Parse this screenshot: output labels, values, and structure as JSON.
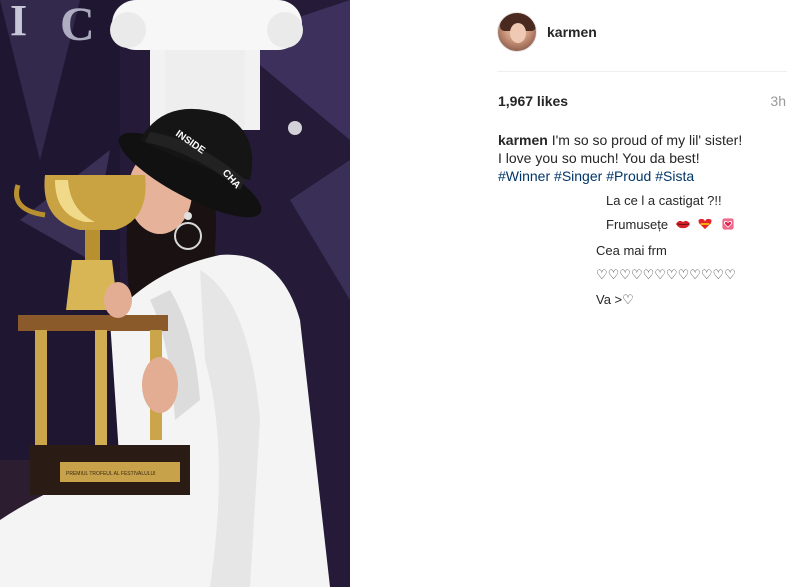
{
  "post": {
    "username": "karmen",
    "likes": "1,967 likes",
    "time": "3h",
    "caption": {
      "author": "karmen",
      "line1": "I'm so so proud of my lil' sister!",
      "line2": "I love you so much! You da best!",
      "hashtags": [
        "#Winner",
        "#Singer",
        "#Proud",
        "#Sista"
      ]
    }
  },
  "comments": [
    {
      "text": "La ce l a castigat ?!!"
    },
    {
      "text": "Frumusețe"
    },
    {
      "text": "Cea mai frm"
    },
    {
      "text": "♡♡♡♡♡♡♡♡♡♡♡♡"
    },
    {
      "text": "Va >♡"
    }
  ],
  "photo": {
    "hat_text_1": "INSIDE",
    "hat_text_2": "CHA",
    "plaque_text": "PREMIUL TROFEUL AL FESTIVALULUI"
  },
  "colors": {
    "hashtag": "#003569",
    "muted": "#999999",
    "text": "#262626"
  },
  "icons": [
    "avatar-photo",
    "kiss-lips-emoji",
    "heart-emoji",
    "heart-box-emoji"
  ]
}
